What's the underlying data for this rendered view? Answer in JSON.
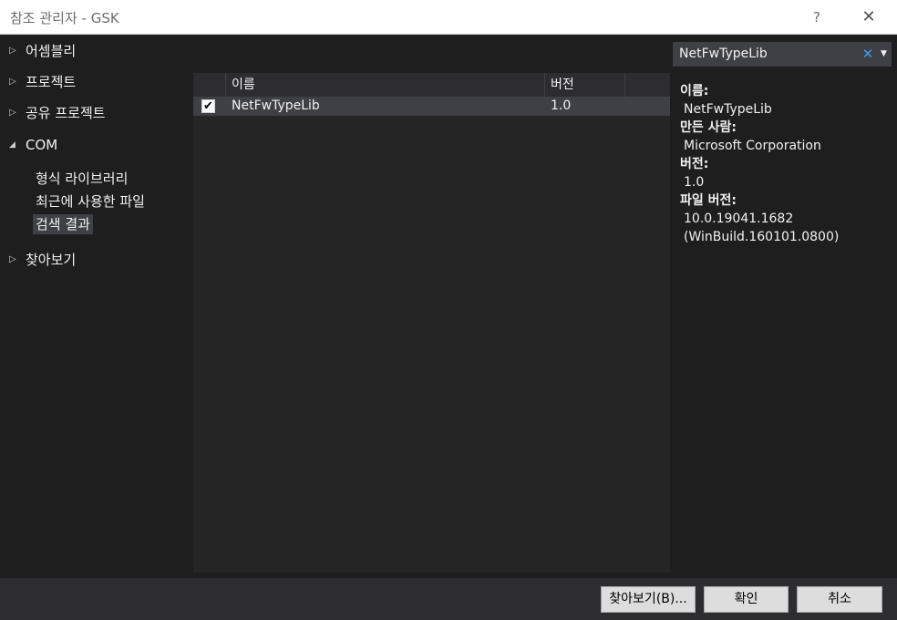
{
  "window": {
    "title": "참조 관리자 - GSK",
    "help": "?",
    "close": "✕"
  },
  "tree": {
    "nodes": [
      {
        "label": "어셈블리",
        "expanded": false
      },
      {
        "label": "프로젝트",
        "expanded": false
      },
      {
        "label": "공유 프로젝트",
        "expanded": false
      },
      {
        "label": "COM",
        "expanded": true
      },
      {
        "label": "찾아보기",
        "expanded": false
      }
    ],
    "com_children": [
      "형식 라이브러리",
      "최근에 사용한 파일",
      "검색 결과"
    ],
    "selected_child": "검색 결과",
    "arrow_collapsed": "▷",
    "arrow_expanded": "◢"
  },
  "list": {
    "columns": [
      "이름",
      "버전"
    ],
    "rows": [
      {
        "checked": true,
        "name": "NetFwTypeLib",
        "version": "1.0"
      }
    ],
    "check_glyph": "✔"
  },
  "search": {
    "value": "NetFwTypeLib",
    "clear_icon": "✕",
    "dropdown_icon": "▼"
  },
  "details": {
    "name_label": "이름:",
    "name_value": "NetFwTypeLib",
    "author_label": "만든 사람:",
    "author_value": "Microsoft Corporation",
    "version_label": "버전:",
    "version_value": "1.0",
    "file_version_label": "파일 버전:",
    "file_version_value1": "10.0.19041.1682",
    "file_version_value2": "(WinBuild.160101.0800)"
  },
  "buttons": {
    "browse": "찾아보기(B)...",
    "ok": "확인",
    "cancel": "취소"
  }
}
